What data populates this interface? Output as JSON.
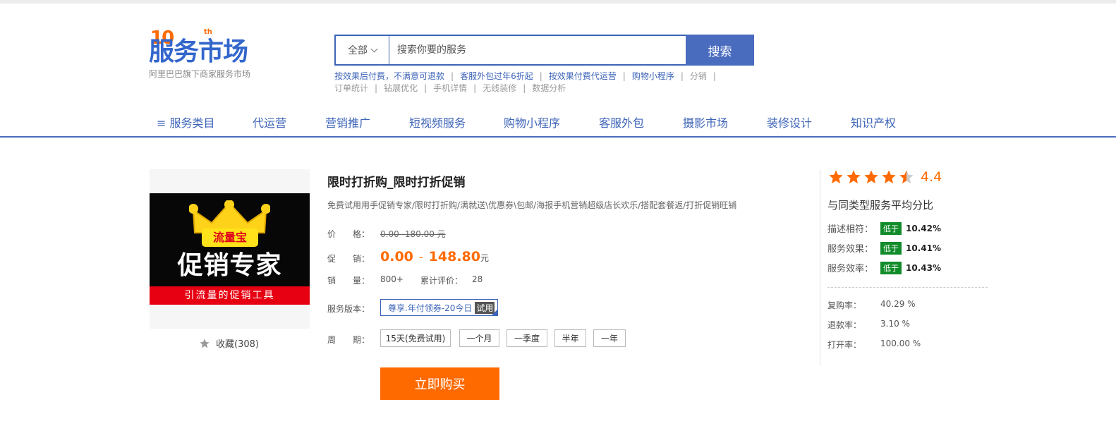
{
  "header": {
    "logo_main": "服务市场",
    "logo_ten": "10",
    "logo_th": "th",
    "logo_sub": "阿里巴巴旗下商家服务市场"
  },
  "search": {
    "category": "全部",
    "placeholder": "搜索你要的服务",
    "button": "搜索"
  },
  "hot_links": {
    "row1": [
      "按效果后付费，不满意可退款",
      "客服外包过年6折起",
      "按效果付费代运营",
      "购物小程序",
      "分销"
    ],
    "row2": [
      "订单统计",
      "钻展优化",
      "手机详情",
      "无线装修",
      "数据分析"
    ]
  },
  "nav": {
    "items": [
      "服务类目",
      "代运营",
      "营销推广",
      "短视频服务",
      "购物小程序",
      "客服外包",
      "摄影市场",
      "装修设计",
      "知识产权"
    ]
  },
  "product": {
    "image": {
      "badge": "流量宝",
      "headline": "促销专家",
      "subline": "引流量的促销工具"
    },
    "favorite": "收藏(308)",
    "title": "限时打折购_限时打折促销",
    "description": "免费试用用手促销专家/限时打折购/满就送\\优惠券\\包邮/海报手机营销超级店长欢乐/搭配套餐返/打折促销旺铺",
    "price_label": "价　　格：",
    "price_value": "0.00 -180.00 元",
    "promo_label": "促　　销：",
    "promo_low": "0.00",
    "promo_dash": "-",
    "promo_high": "148.80",
    "promo_unit": "元",
    "sales_label": "销　　量：",
    "sales_value": "800+",
    "reviews_label": "累计评价：",
    "reviews_value": "28",
    "version_label": "服务版本：",
    "version_value": "尊享.年付领券-20今日",
    "version_trial": "试用",
    "period_label": "周　　期：",
    "periods": [
      "15天(免费试用)",
      "一个月",
      "一季度",
      "半年",
      "一年"
    ],
    "buy_button": "立即购买"
  },
  "rating": {
    "stars": 4.4,
    "score": "4.4",
    "compare_title": "与同类型服务平均分比",
    "metrics": [
      {
        "label": "描述相符：",
        "badge": "低于",
        "value": "10.42%"
      },
      {
        "label": "服务效果：",
        "badge": "低于",
        "value": "10.41%"
      },
      {
        "label": "服务效率：",
        "badge": "低于",
        "value": "10.43%"
      }
    ],
    "rates": [
      {
        "label": "复购率：",
        "value": "40.29 %"
      },
      {
        "label": "退款率：",
        "value": "3.10 %"
      },
      {
        "label": "打开率：",
        "value": "100.00 %"
      }
    ]
  },
  "colors": {
    "brand_blue": "#3d64b8",
    "accent_orange": "#ff6a00",
    "badge_green": "#128c2a"
  }
}
